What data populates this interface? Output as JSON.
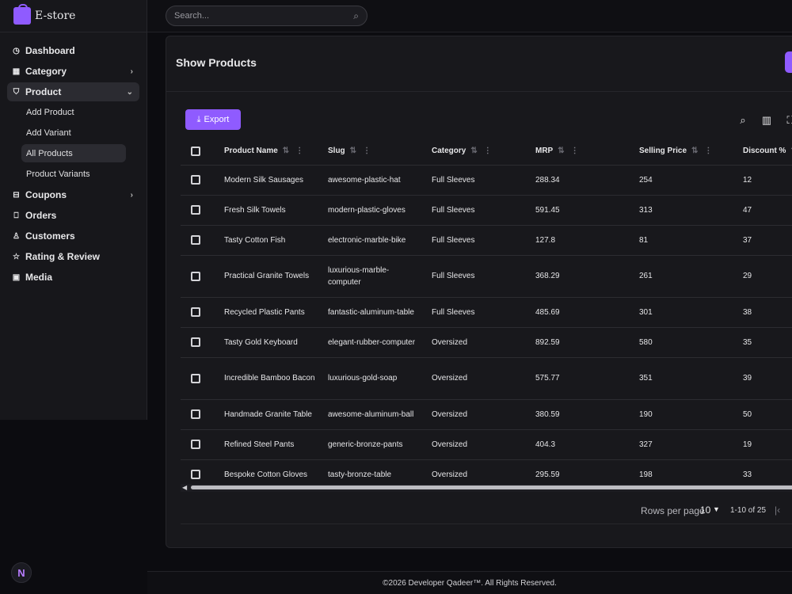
{
  "app": {
    "name": "E-store"
  },
  "search": {
    "placeholder": "Search..."
  },
  "sidebar": {
    "items": [
      {
        "label": "Dashboard",
        "icon": "gauge-icon"
      },
      {
        "label": "Category",
        "icon": "grid-icon"
      },
      {
        "label": "Product",
        "icon": "shirt-icon",
        "children": [
          "Add Product",
          "Add Variant",
          "All Products",
          "Product Variants"
        ],
        "active_child": "All Products"
      },
      {
        "label": "Coupons",
        "icon": "ticket-icon"
      },
      {
        "label": "Orders",
        "icon": "bag-icon"
      },
      {
        "label": "Customers",
        "icon": "user-icon"
      },
      {
        "label": "Rating & Review",
        "icon": "star-icon"
      },
      {
        "label": "Media",
        "icon": "image-icon"
      }
    ]
  },
  "page": {
    "title": "Show Products"
  },
  "toolbar": {
    "export_label": "Export"
  },
  "table": {
    "headers": [
      "Product Name",
      "Slug",
      "Category",
      "MRP",
      "Selling Price",
      "Discount %"
    ],
    "rows": [
      [
        "Modern Silk Sausages",
        "awesome-plastic-hat",
        "Full Sleeves",
        "288.34",
        "254",
        "12"
      ],
      [
        "Fresh Silk Towels",
        "modern-plastic-gloves",
        "Full Sleeves",
        "591.45",
        "313",
        "47"
      ],
      [
        "Tasty Cotton Fish",
        "electronic-marble-bike",
        "Full Sleeves",
        "127.8",
        "81",
        "37"
      ],
      [
        "Practical Granite Towels",
        "luxurious-marble-computer",
        "Full Sleeves",
        "368.29",
        "261",
        "29"
      ],
      [
        "Recycled Plastic Pants",
        "fantastic-aluminum-table",
        "Full Sleeves",
        "485.69",
        "301",
        "38"
      ],
      [
        "Tasty Gold Keyboard",
        "elegant-rubber-computer",
        "Oversized",
        "892.59",
        "580",
        "35"
      ],
      [
        "Incredible Bamboo Bacon",
        "luxurious-gold-soap",
        "Oversized",
        "575.77",
        "351",
        "39"
      ],
      [
        "Handmade Granite Table",
        "awesome-aluminum-ball",
        "Oversized",
        "380.59",
        "190",
        "50"
      ],
      [
        "Refined Steel Pants",
        "generic-bronze-pants",
        "Oversized",
        "404.3",
        "327",
        "19"
      ],
      [
        "Bespoke Cotton Gloves",
        "tasty-bronze-table",
        "Oversized",
        "295.59",
        "198",
        "33"
      ]
    ]
  },
  "pagination": {
    "rows_per_page_label": "Rows per page",
    "rows_per_page": "10",
    "range": "1-10 of 25"
  },
  "footer": {
    "text": "©2026 Developer Qadeer™. All Rights Reserved."
  },
  "colors": {
    "accent": "#8f5bff",
    "background": "#0c0c10",
    "panel": "#18181c"
  }
}
